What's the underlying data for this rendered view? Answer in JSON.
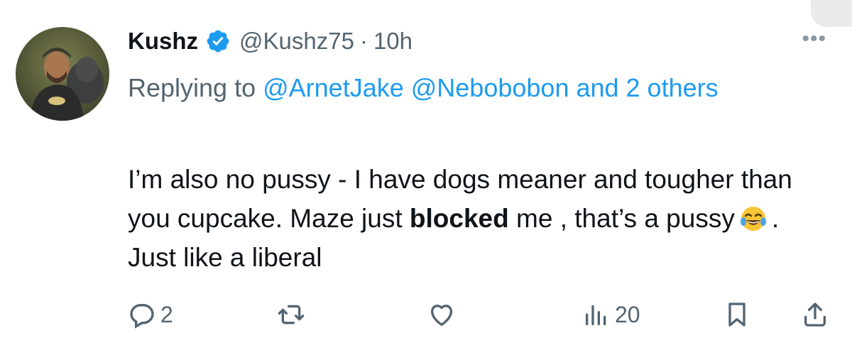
{
  "tweet": {
    "author_name": "Kushz",
    "handle": "@Kushz75",
    "separator": "·",
    "time": "10h",
    "more_label": "•••",
    "replying_prefix": "Replying to ",
    "replying_mentions": "@ArnetJake @Nebobobon and 2 others",
    "text": {
      "part1": "I’m also no pussy - I have dogs meaner and tougher than you cupcake. Maze just ",
      "bold": "blocked",
      "part2": " me , that’s a pussy",
      "emoji": "joy-emoji",
      "part3": ".  Just like a liberal"
    }
  },
  "actions": {
    "reply_count": "2",
    "retweet_count": "",
    "like_count": "",
    "views_count": "20"
  },
  "colors": {
    "text": "#0f1419",
    "secondary": "#536471",
    "link": "#1d9bf0",
    "verified": "#1d9bf0"
  },
  "icons": [
    "verified-icon",
    "more-icon",
    "reply-icon",
    "retweet-icon",
    "like-icon",
    "views-icon",
    "bookmark-icon",
    "share-icon"
  ]
}
